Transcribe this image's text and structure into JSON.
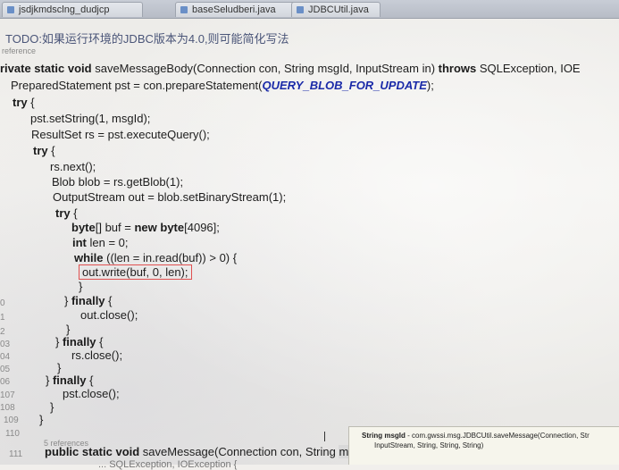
{
  "tabs": [
    {
      "label": "jsdjkmdsclng_dudjcp"
    },
    {
      "label": "baseSeludberi.java"
    },
    {
      "label": "JDBCUtil.java"
    }
  ],
  "todo_comment": "TODO:如果运行环境的JDBC版本为4.0,则可能简化写法",
  "reference_label": "reference",
  "code": {
    "l1_a": "rivate static void",
    "l1_b": " saveMessageBody(Connection con, String msgId, InputStream in) ",
    "l1_c": "throws",
    "l1_d": " SQLException, IOE",
    "l2_a": "PreparedStatement pst = con.prepareStatement(",
    "l2_b": "QUERY_BLOB_FOR_UPDATE",
    "l2_c": ");",
    "l3": "try",
    "l3_brace": " {",
    "l4": "pst.setString(1, msgId);",
    "l5": "ResultSet rs = pst.executeQuery();",
    "l6": "try",
    "l6_brace": " {",
    "l7": "rs.next();",
    "l8": "Blob blob = rs.getBlob(1);",
    "l9": "OutputStream out = blob.setBinaryStream(1);",
    "l10": "try",
    "l10_brace": " {",
    "l11_a": "byte",
    "l11_b": "[] buf = ",
    "l11_c": "new",
    "l11_d": " ",
    "l11_e": "byte",
    "l11_f": "[4096];",
    "l12_a": "int",
    "l12_b": " len = 0;",
    "l13_a": "while",
    "l13_b": " ((len = in.read(buf)) > 0) {",
    "l14": "out.write(buf, 0, len);",
    "l15": "}",
    "l16_a": "} ",
    "l16_b": "finally",
    "l16_c": " {",
    "l17": "out.close();",
    "l18": "}",
    "l19_a": "} ",
    "l19_b": "finally",
    "l19_c": " {",
    "l20": "rs.close();",
    "l21": "}",
    "l22_a": "} ",
    "l22_b": "finally",
    "l22_c": " {",
    "l23": "pst.close();",
    "l24": "}",
    "l25": "}",
    "refs_label": "5 references",
    "l27_a": "public static void",
    "l27_b": " saveMessage(Connection con, String ",
    "l27_c": "msgId",
    "l27_d": ",",
    "l28": "... SQLException, IOException {"
  },
  "line_numbers": [
    "0",
    "1",
    "2",
    "03",
    "04",
    "05",
    "06",
    "107",
    "108",
    "109",
    "110",
    "111"
  ],
  "tooltip": {
    "line1_a": "String msgId",
    "line1_b": " - com.gwssi.msg.JDBCUtil.saveMessage(Connection, Str",
    "line2": "InputStream, String, String, String)"
  }
}
